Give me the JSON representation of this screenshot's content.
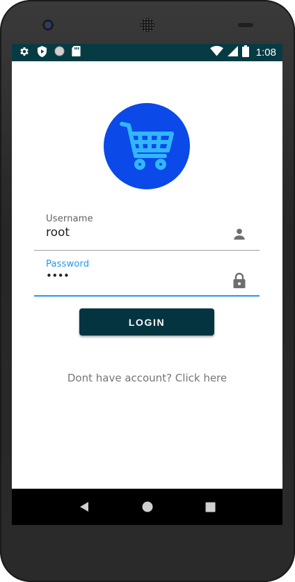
{
  "status_bar": {
    "time": "1:08",
    "left_icons": [
      "settings-icon",
      "play-protect-icon",
      "circle-icon",
      "sd-card-icon"
    ],
    "right_icons": [
      "wifi-icon",
      "signal-icon",
      "battery-icon"
    ]
  },
  "logo": {
    "icon": "shopping-cart-icon",
    "background": "#0b49e8",
    "icon_color": "#31b6ff"
  },
  "form": {
    "username": {
      "label": "Username",
      "value": "root",
      "icon": "person-icon"
    },
    "password": {
      "label": "Password",
      "value": "••••",
      "icon": "lock-icon"
    }
  },
  "login_button": {
    "label": "LOGIN"
  },
  "signup_link": {
    "text": "Dont have account? Click here"
  },
  "nav_bar": {
    "buttons": [
      "back-icon",
      "home-icon",
      "recents-icon"
    ]
  },
  "colors": {
    "accent": "#2196f3",
    "status_bar": "#073b43",
    "button": "#053441"
  }
}
